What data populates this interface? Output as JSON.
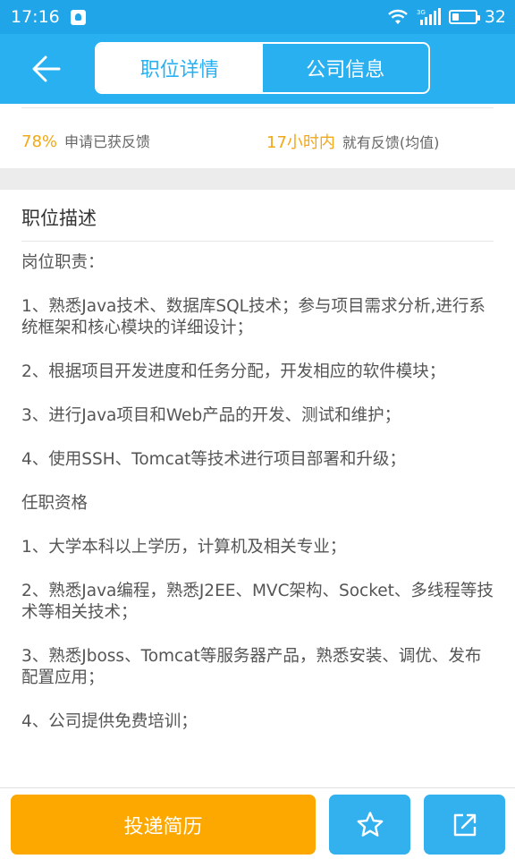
{
  "status_bar": {
    "time": "17:16",
    "battery": "32",
    "network": "3G"
  },
  "header": {
    "tabs": [
      {
        "label": "职位详情",
        "active": true
      },
      {
        "label": "公司信息",
        "active": false
      }
    ]
  },
  "feedback": {
    "rate_value": "78%",
    "rate_label": "申请已获反馈",
    "time_value": "17小时内",
    "time_label": "就有反馈(均值)"
  },
  "description": {
    "title": "职位描述",
    "paragraphs": [
      "岗位职责：",
      "1、熟悉Java技术、数据库SQL技术；参与项目需求分析,进行系统框架和核心模块的详细设计；",
      "2、根据项目开发进度和任务分配，开发相应的软件模块；",
      "3、进行Java项目和Web产品的开发、测试和维护；",
      "4、使用SSH、Tomcat等技术进行项目部署和升级；",
      "任职资格",
      "1、大学本科以上学历，计算机及相关专业；",
      "2、熟悉Java编程，熟悉J2EE、MVC架构、Socket、多线程等技术等相关技术；",
      "3、熟悉Jboss、Tomcat等服务器产品，熟悉安装、调优、发布配置应用；",
      "4、公司提供免费培训；"
    ]
  },
  "bottom_bar": {
    "apply_label": "投递简历",
    "favorite_icon": "star-icon",
    "share_icon": "share-icon"
  },
  "colors": {
    "primary": "#29b0f0",
    "accent_orange": "#fda800",
    "highlight_text": "#f2a818"
  }
}
